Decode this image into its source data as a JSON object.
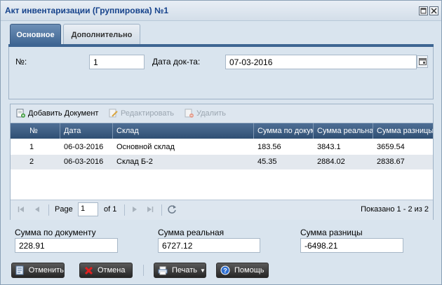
{
  "window": {
    "title": "Акт инвентаризации (Группировка) №1",
    "restore_icon": "window-restore-icon",
    "close_icon": "window-close-icon"
  },
  "tabs": [
    {
      "label": "Основное",
      "active": true
    },
    {
      "label": "Дополнительно",
      "active": false
    }
  ],
  "form": {
    "number_label": "№:",
    "number_value": "1",
    "date_label": "Дата док-та:",
    "date_value": "07-03-2016",
    "calendar_icon": "calendar-icon"
  },
  "grid": {
    "toolbar": {
      "add_label": "Добавить Документ",
      "edit_label": "Редактировать",
      "delete_label": "Удалить"
    },
    "columns": [
      "№",
      "Дата",
      "Склад",
      "Сумма по документу",
      "Сумма реальная",
      "Сумма разницы"
    ],
    "rows": [
      {
        "num": "1",
        "date": "06-03-2016",
        "warehouse": "Основной склад",
        "doc_sum": "183.56",
        "real_sum": "3843.1",
        "diff_sum": "3659.54"
      },
      {
        "num": "2",
        "date": "06-03-2016",
        "warehouse": "Склад Б-2",
        "doc_sum": "45.35",
        "real_sum": "2884.02",
        "diff_sum": "2838.67"
      }
    ],
    "pager": {
      "page_label": "Page",
      "page_value": "1",
      "of_label": "of 1",
      "shown_label": "Показано 1 - 2 из 2"
    }
  },
  "totals": {
    "doc_label": "Сумма по документу",
    "doc_value": "228.91",
    "real_label": "Сумма реальная",
    "real_value": "6727.12",
    "diff_label": "Сумма разницы",
    "diff_value": "-6498.21"
  },
  "buttons": {
    "cancel_doc": "Отменить",
    "cancel": "Отмена",
    "print": "Печать",
    "help": "Помощь"
  },
  "colors": {
    "accent": "#3e6592",
    "header": "#2f4f73",
    "window_bg": "#d9e4ee"
  }
}
